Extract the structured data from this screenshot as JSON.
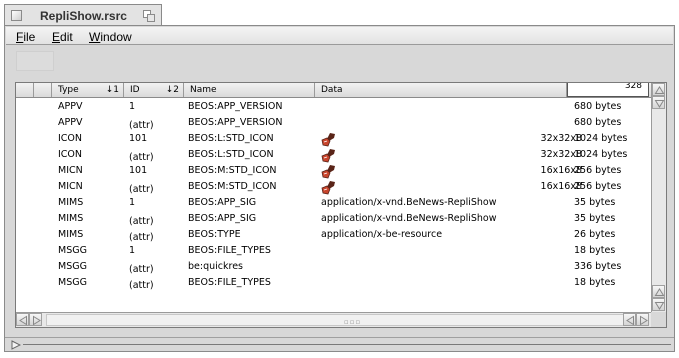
{
  "window": {
    "title": "RepliShow.rsrc"
  },
  "menubar": {
    "items": [
      "File",
      "Edit",
      "Window"
    ],
    "mnemonics": [
      "F",
      "E",
      "W"
    ]
  },
  "columns": {
    "type": "Type",
    "type_sort": "↓1",
    "id": "ID",
    "id_sort": "↓2",
    "name": "Name",
    "data": "Data",
    "size_header_value": "328"
  },
  "rows": [
    {
      "type": "APPV",
      "id": "1",
      "name": "BEOS:APP_VERSION",
      "data": "",
      "dims": "",
      "icon": "",
      "size": "680 bytes"
    },
    {
      "type": "APPV",
      "id": "(attr)",
      "name": "BEOS:APP_VERSION",
      "data": "",
      "dims": "",
      "icon": "",
      "size": "680 bytes"
    },
    {
      "type": "ICON",
      "id": "101",
      "name": "BEOS:L:STD_ICON",
      "data": "",
      "dims": "32x32x8",
      "icon": "paint-brush-icon",
      "size": "1024 bytes"
    },
    {
      "type": "ICON",
      "id": "(attr)",
      "name": "BEOS:L:STD_ICON",
      "data": "",
      "dims": "32x32x8",
      "icon": "paint-brush-icon",
      "size": "1024 bytes"
    },
    {
      "type": "MICN",
      "id": "101",
      "name": "BEOS:M:STD_ICON",
      "data": "",
      "dims": "16x16x8",
      "icon": "paint-brush-icon",
      "size": "256 bytes"
    },
    {
      "type": "MICN",
      "id": "(attr)",
      "name": "BEOS:M:STD_ICON",
      "data": "",
      "dims": "16x16x8",
      "icon": "paint-brush-icon",
      "size": "256 bytes"
    },
    {
      "type": "MIMS",
      "id": "1",
      "name": "BEOS:APP_SIG",
      "data": "application/x-vnd.BeNews-RepliShow",
      "dims": "",
      "icon": "",
      "size": "35 bytes"
    },
    {
      "type": "MIMS",
      "id": "(attr)",
      "name": "BEOS:APP_SIG",
      "data": "application/x-vnd.BeNews-RepliShow",
      "dims": "",
      "icon": "",
      "size": "35 bytes"
    },
    {
      "type": "MIMS",
      "id": "(attr)",
      "name": "BEOS:TYPE",
      "data": "application/x-be-resource",
      "dims": "",
      "icon": "",
      "size": "26 bytes"
    },
    {
      "type": "MSGG",
      "id": "1",
      "name": "BEOS:FILE_TYPES",
      "data": "",
      "dims": "",
      "icon": "",
      "size": "18 bytes"
    },
    {
      "type": "MSGG",
      "id": "(attr)",
      "name": "be:quickres",
      "data": "",
      "dims": "",
      "icon": "",
      "size": "336 bytes"
    },
    {
      "type": "MSGG",
      "id": "(attr)",
      "name": "BEOS:FILE_TYPES",
      "data": "",
      "dims": "",
      "icon": "",
      "size": "18 bytes"
    }
  ],
  "colors": {
    "window_bg": "#d8d8d8",
    "icon_red": "#c8452d",
    "icon_dark": "#5a2418"
  }
}
